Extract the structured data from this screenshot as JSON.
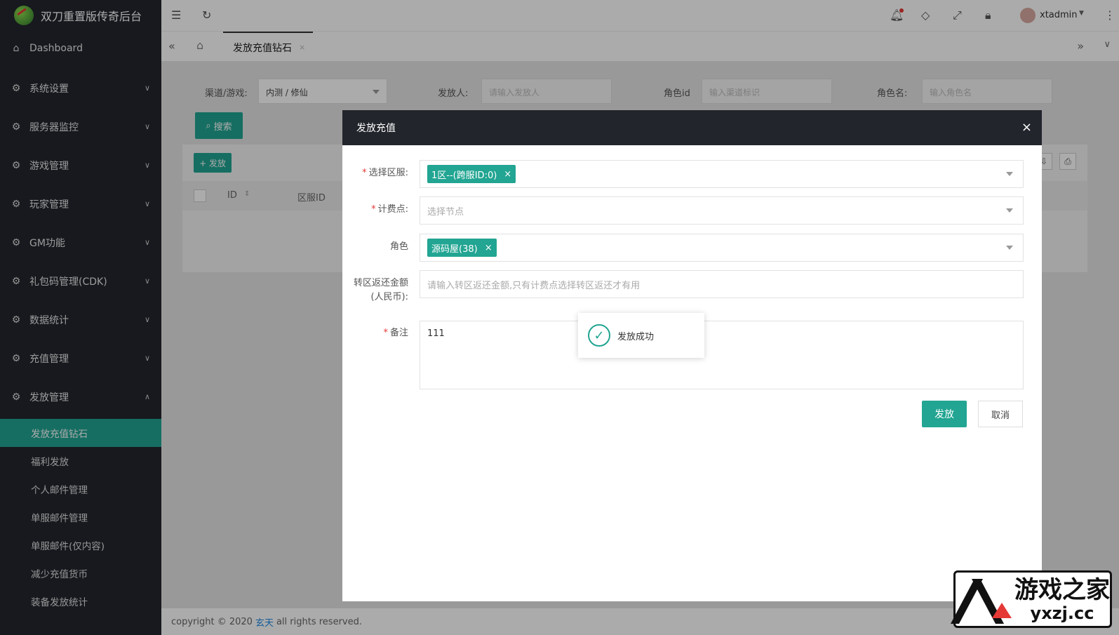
{
  "app": {
    "title": "双刀重置版传奇后台"
  },
  "sidebar": {
    "dashboard": "Dashboard",
    "items": [
      {
        "label": "系统设置"
      },
      {
        "label": "服务器监控"
      },
      {
        "label": "游戏管理"
      },
      {
        "label": "玩家管理"
      },
      {
        "label": "GM功能"
      },
      {
        "label": "礼包码管理(CDK)"
      },
      {
        "label": "数据统计"
      },
      {
        "label": "充值管理"
      },
      {
        "label": "发放管理"
      }
    ],
    "sub_items": [
      {
        "label": "发放充值钻石"
      },
      {
        "label": "福利发放"
      },
      {
        "label": "个人邮件管理"
      },
      {
        "label": "单服邮件管理"
      },
      {
        "label": "单服邮件(仅内容)"
      },
      {
        "label": "减少充值货币"
      },
      {
        "label": "装备发放统计"
      }
    ]
  },
  "topbar": {
    "username": "xtadmin"
  },
  "tabs": {
    "active": "发放充值钻石",
    "close": "×"
  },
  "filter": {
    "channel_label": "渠道/游戏:",
    "channel_value": "内测 / 修仙",
    "issuer_label": "发放人:",
    "issuer_placeholder": "请输入发放人",
    "role_id_label": "角色id",
    "role_id_placeholder": "输入渠道标识",
    "role_name_label": "角色名:",
    "role_name_placeholder": "输入角色名",
    "search": "搜索",
    "issue": "+ 发放"
  },
  "table": {
    "col_id": "ID",
    "col_server": "区服ID"
  },
  "modal": {
    "title": "发放充值",
    "close": "×",
    "server_label": "选择区服:",
    "server_tag": "1区--(跨服ID:0)",
    "billing_label": "计费点:",
    "billing_placeholder": "选择节点",
    "role_label": "角色",
    "role_tag": "源码屋(38)",
    "refund_label": "转区返还金额(人民币):",
    "refund_placeholder": "请输入转区返还金额,只有计费点选择转区返还才有用",
    "note_label": "备注",
    "note_value": "111",
    "submit": "发放",
    "cancel": "取消"
  },
  "toast": {
    "message": "发放成功"
  },
  "footer": {
    "prefix": "copyright © 2020",
    "link": "玄天",
    "suffix": "all rights reserved."
  },
  "watermark": {
    "name": "游戏之家",
    "domain": "yxzj.cc"
  },
  "colors": {
    "accent": "#22a592",
    "sidebar": "#23262e",
    "danger": "#e53935"
  }
}
